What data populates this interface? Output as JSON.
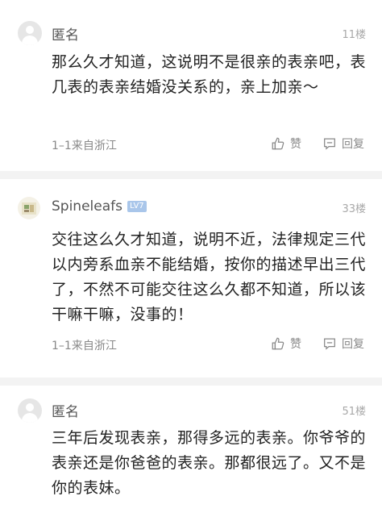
{
  "comments": [
    {
      "username": "匿名",
      "floor": "11楼",
      "content": "那么久才知道，这说明不是很亲的表亲吧，表几表的表亲结婚没关系的，亲上加亲～",
      "meta": "1–1来自浙江",
      "like_label": "赞",
      "reply_label": "回复"
    },
    {
      "username": "Spineleafs",
      "level": "LV7",
      "floor": "33楼",
      "content": "交往这么久才知道，说明不近，法律规定三代以内旁系血亲不能结婚，按你的描述早出三代了，不然不可能交往这么久都不知道，所以该干嘛干嘛，没事的！",
      "meta": "1–1来自浙江",
      "like_label": "赞",
      "reply_label": "回复"
    },
    {
      "username": "匿名",
      "floor": "51楼",
      "content": "三年后发现表亲，那得多远的表亲。你爷爷的表亲还是你爸爸的表亲。那都很远了。又不是你的表妹。"
    }
  ]
}
